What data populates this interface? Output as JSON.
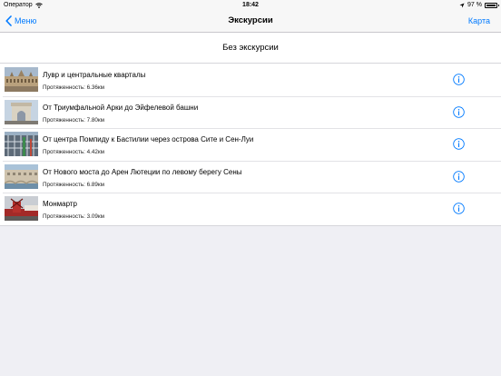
{
  "status": {
    "carrier": "Оператор",
    "time": "18:42",
    "battery": "97 %",
    "battery_level": 0.97
  },
  "nav": {
    "back_label": "Меню",
    "title": "Экскурсии",
    "right_label": "Карта"
  },
  "no_excursion_label": "Без экскурсии",
  "excursions": [
    {
      "title": "Лувр и центральные кварталы",
      "distance": "Протяженность: 6.36км",
      "image": "louvre"
    },
    {
      "title": "От Триумфальной Арки до Эйфелевой башни",
      "distance": "Протяженность: 7.80км",
      "image": "arc-de-triomphe"
    },
    {
      "title": "От центра Помпиду к Бастилии через острова Сите и Сен-Луи",
      "distance": "Протяженность: 4.42км",
      "image": "pompidou"
    },
    {
      "title": "От Нового моста до Арен Лютеции по левому берегу Сены",
      "distance": "Протяженность: 6.89км",
      "image": "pont-neuf"
    },
    {
      "title": "Монмартр",
      "distance": "Протяженность: 3.09км",
      "image": "moulin-rouge"
    }
  ],
  "colors": {
    "accent": "#007aff",
    "background": "#efeff4",
    "separator": "#d6d6da"
  }
}
